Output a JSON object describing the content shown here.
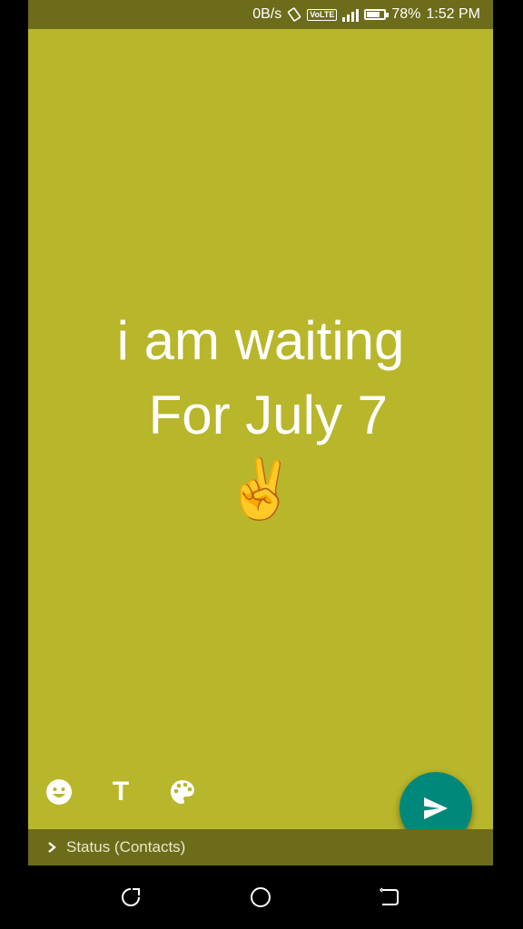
{
  "statusbar": {
    "network_speed": "0B/s",
    "volte": "VoLTE",
    "lte": "LTE",
    "battery_percent": "78%",
    "battery_level": 0.78,
    "time": "1:52 PM"
  },
  "status": {
    "line1": "i am waiting",
    "line2": " For July 7",
    "emoji": "✌️",
    "background_color": "#b8b62a"
  },
  "toolbar": {
    "emoji_icon": "emoji-icon",
    "text_icon_label": "T",
    "palette_icon": "palette-icon"
  },
  "send": {
    "icon": "send-icon",
    "color": "#00897b"
  },
  "audience": {
    "chevron": "chevron-right-icon",
    "label": "Status (Contacts)"
  },
  "navbar": {
    "items": [
      "recent-apps-icon",
      "home-icon",
      "back-icon"
    ]
  }
}
